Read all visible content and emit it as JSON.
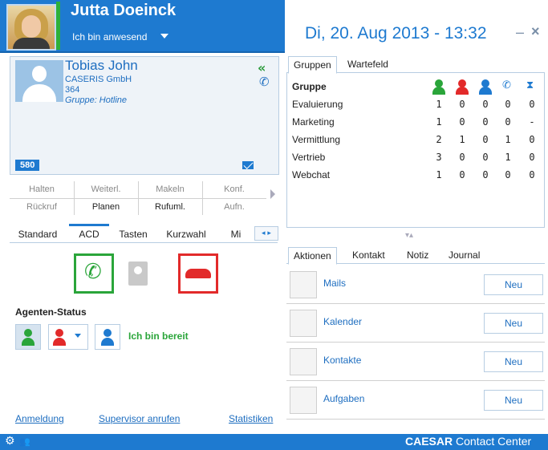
{
  "header": {
    "user_name": "Jutta Doeinck",
    "status": "Ich bin anwesend",
    "date_time": "Di, 20. Aug 2013 - 13:32",
    "minimize_label": "–",
    "close_label": "×"
  },
  "contact": {
    "name": "Tobias John",
    "company": "CASERIS GmbH",
    "extension": "364",
    "group": "Gruppe: Hotline",
    "badge": "580"
  },
  "call_controls": {
    "row1": [
      "Halten",
      "Weiterl.",
      "Makeln",
      "Konf."
    ],
    "row2": [
      "Rückruf",
      "Planen",
      "Rufuml.",
      "Aufn."
    ]
  },
  "left_tabs": [
    "Standard",
    "ACD",
    "Tasten",
    "Kurzwahl",
    "Mi"
  ],
  "agent_status": {
    "title": "Agenten-Status",
    "state_text": "Ich bin bereit"
  },
  "footer_links": [
    "Anmeldung",
    "Supervisor anrufen",
    "Statistiken"
  ],
  "groups": {
    "tabs": [
      "Gruppen",
      "Wartefeld"
    ],
    "header": "Gruppe",
    "rows": [
      {
        "name": "Evaluierung",
        "vals": [
          "1",
          "0",
          "0",
          "0",
          "0"
        ]
      },
      {
        "name": "Marketing",
        "vals": [
          "1",
          "0",
          "0",
          "0",
          "-"
        ]
      },
      {
        "name": "Vermittlung",
        "vals": [
          "2",
          "1",
          "0",
          "1",
          "0"
        ]
      },
      {
        "name": "Vertrieb",
        "vals": [
          "3",
          "0",
          "0",
          "1",
          "0"
        ]
      },
      {
        "name": "Webchat",
        "vals": [
          "1",
          "0",
          "0",
          "0",
          "0"
        ]
      }
    ]
  },
  "actions": {
    "tabs": [
      "Aktionen",
      "Kontakt",
      "Notiz",
      "Journal"
    ],
    "items": [
      {
        "label": "Mails",
        "button": "Neu"
      },
      {
        "label": "Kalender",
        "button": "Neu"
      },
      {
        "label": "Kontakte",
        "button": "Neu"
      },
      {
        "label": "Aufgaben",
        "button": "Neu"
      }
    ]
  },
  "footer": {
    "brand_bold": "CAESAR",
    "brand_rest": " Contact Center"
  },
  "colors": {
    "accent": "#1e7ad0",
    "green": "#2aa53a",
    "red": "#e22a2a"
  }
}
